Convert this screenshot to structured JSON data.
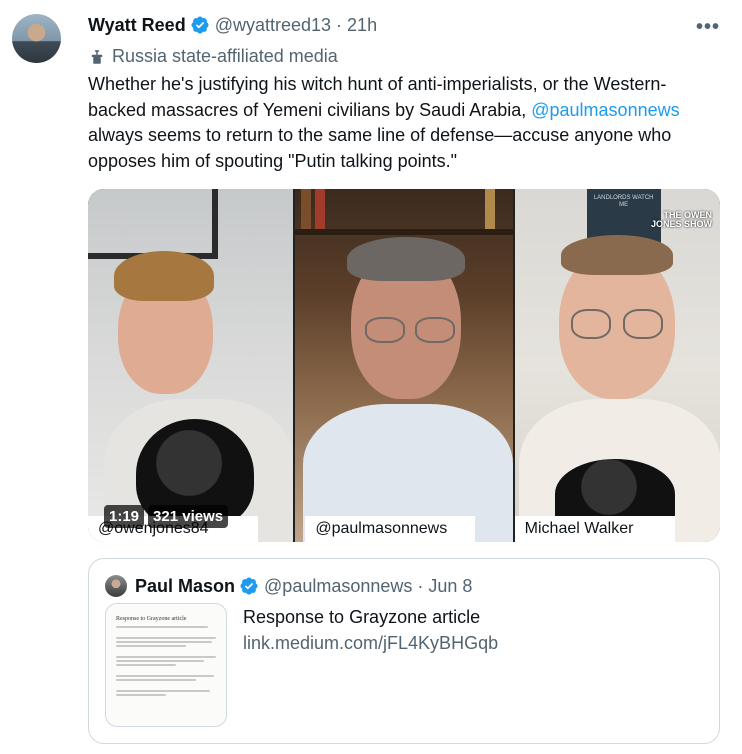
{
  "tweet": {
    "author_name": "Wyatt Reed",
    "author_handle": "@wyattreed13",
    "separator": "·",
    "time": "21h",
    "more_label": "•••",
    "state_label": "Russia state-affiliated media",
    "text_before": "Whether he's justifying his witch hunt of anti-imperialists, or the Western-backed massacres of Yemeni civilians by Saudi Arabia, ",
    "mention": "@paulmasonnews",
    "text_after": " always seems to return to the same line of defense—accuse anyone who opposes him of spouting \"Putin talking points.\""
  },
  "video": {
    "duration": "1:19",
    "views": "321 views",
    "show_logo": "THE OWEN JONES SHOW",
    "poster_text": "LANDLORDS WATCH ME",
    "name_tags": [
      "@owenjones84",
      "@paulmasonnews",
      "Michael Walker"
    ]
  },
  "quote": {
    "author_name": "Paul Mason",
    "author_handle": "@paulmasonnews",
    "separator": "·",
    "date": "Jun 8",
    "thumb_title": "Response to Grayzone article",
    "card_title": "Response to Grayzone article",
    "card_link": "link.medium.com/jFL4KyBHGqb"
  },
  "colors": {
    "verified": "#1d9bf0",
    "mention": "#1d9bf0",
    "secondary_text": "#536471"
  },
  "icons": {
    "verified": "verified-badge-icon",
    "state_media": "podium-icon",
    "more": "more-icon"
  }
}
